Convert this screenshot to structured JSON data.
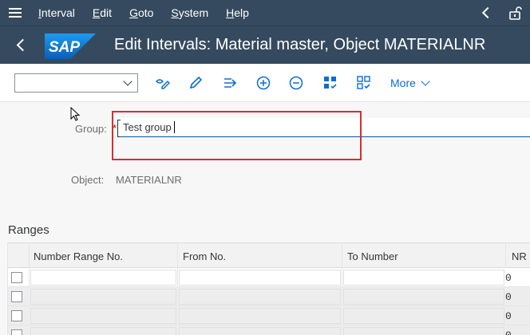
{
  "menubar": {
    "items": [
      {
        "label": "Interval",
        "ul": "I",
        "rest": "nterval"
      },
      {
        "label": "Edit",
        "ul": "E",
        "rest": "dit"
      },
      {
        "label": "Goto",
        "ul": "G",
        "rest": "oto"
      },
      {
        "label": "System",
        "ul": "S",
        "rest": "ystem"
      },
      {
        "label": "Help",
        "ul": "H",
        "rest": "elp"
      }
    ]
  },
  "header": {
    "logo_text": "SAP",
    "title": "Edit Intervals: Material master, Object MATERIALNR"
  },
  "toolbar": {
    "select_value": "",
    "more_label": "More"
  },
  "form": {
    "group_label": "Group:",
    "required_marker": "*",
    "group_value": "Test group",
    "object_label": "Object:",
    "object_value": "MATERIALNR"
  },
  "ranges": {
    "title": "Ranges",
    "columns": [
      "Number Range No.",
      "From No.",
      "To Number",
      "NR"
    ],
    "rows": [
      {
        "nr_status": "0"
      },
      {
        "nr_status": "0"
      },
      {
        "nr_status": "0"
      },
      {
        "nr_status": "0"
      }
    ]
  },
  "colors": {
    "shell": "#354a5f",
    "accent": "#0a6ed1",
    "highlight": "#d32f2f"
  }
}
